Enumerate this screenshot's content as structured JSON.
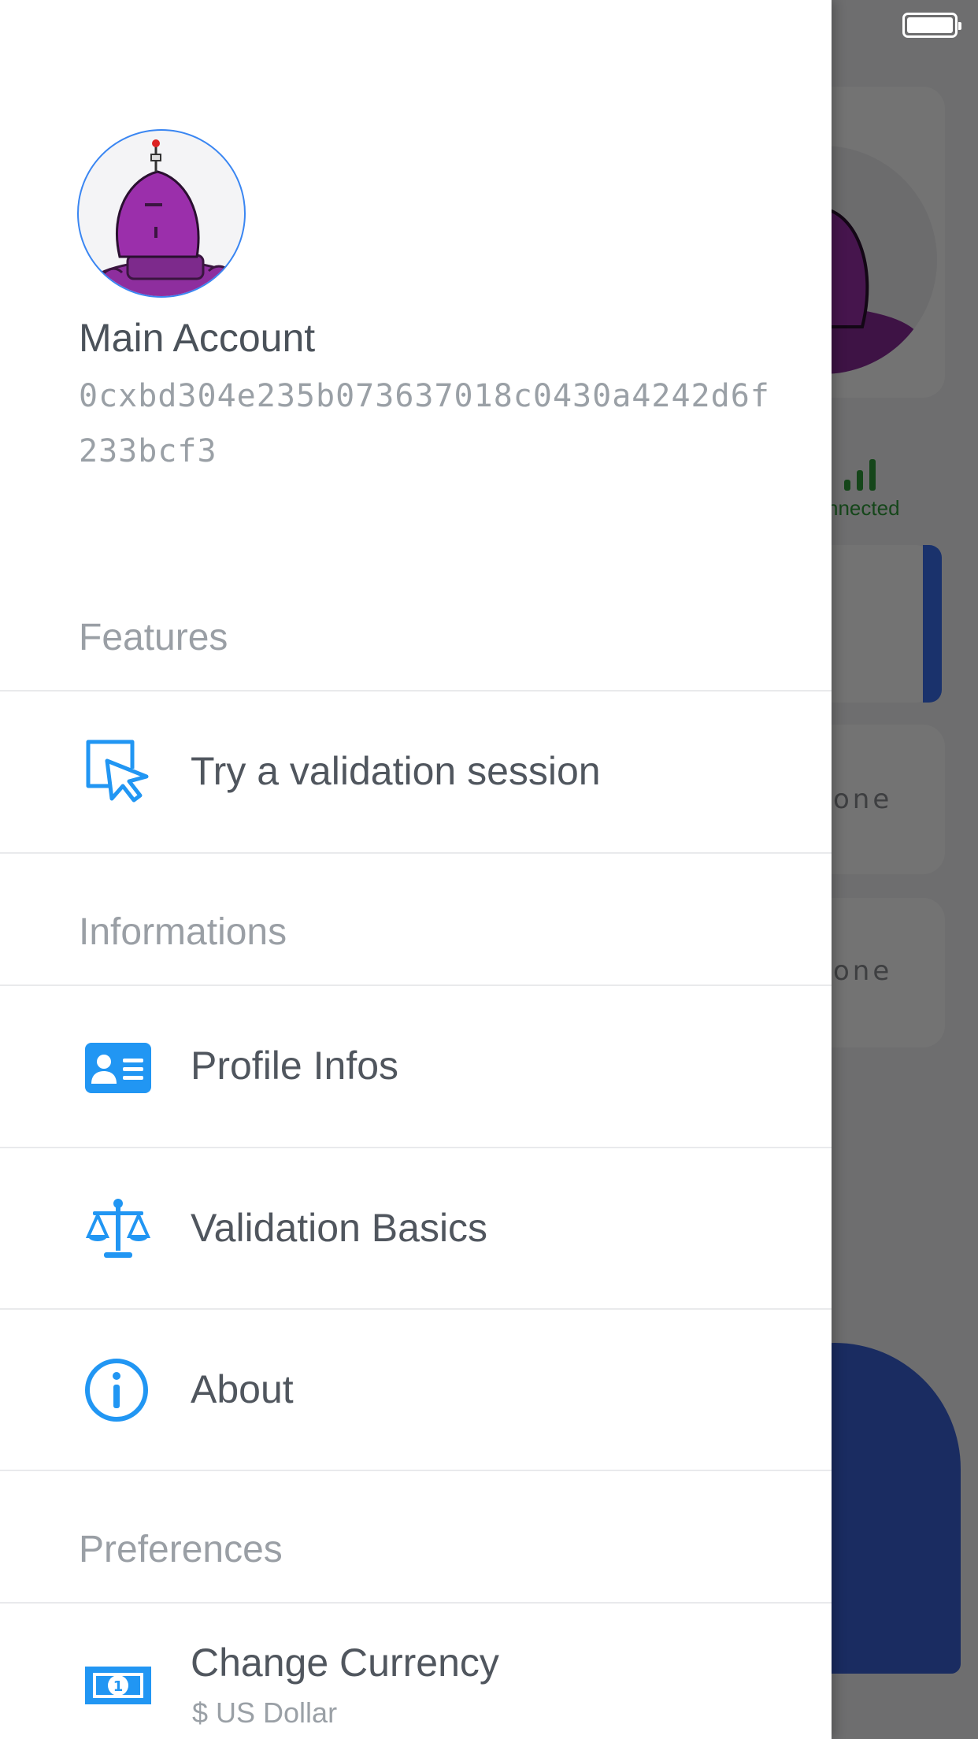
{
  "background": {
    "status_text": "nnected",
    "card_texts": [
      "one",
      "one"
    ]
  },
  "drawer": {
    "account": {
      "name": "Main Account",
      "address": "0cxbd304e235b073637018c0430a4242d6f233bcf3"
    },
    "sections": {
      "features": "Features",
      "informations": "Informations",
      "preferences": "Preferences"
    },
    "items": {
      "validation_session": "Try a validation session",
      "profile_infos": "Profile Infos",
      "validation_basics": "Validation Basics",
      "about": "About",
      "change_currency": "Change Currency",
      "currency_value": "$ US Dollar"
    }
  },
  "colors": {
    "accent": "#2196f3",
    "connected": "#2f9c3a",
    "fab": "#3a63d8"
  }
}
